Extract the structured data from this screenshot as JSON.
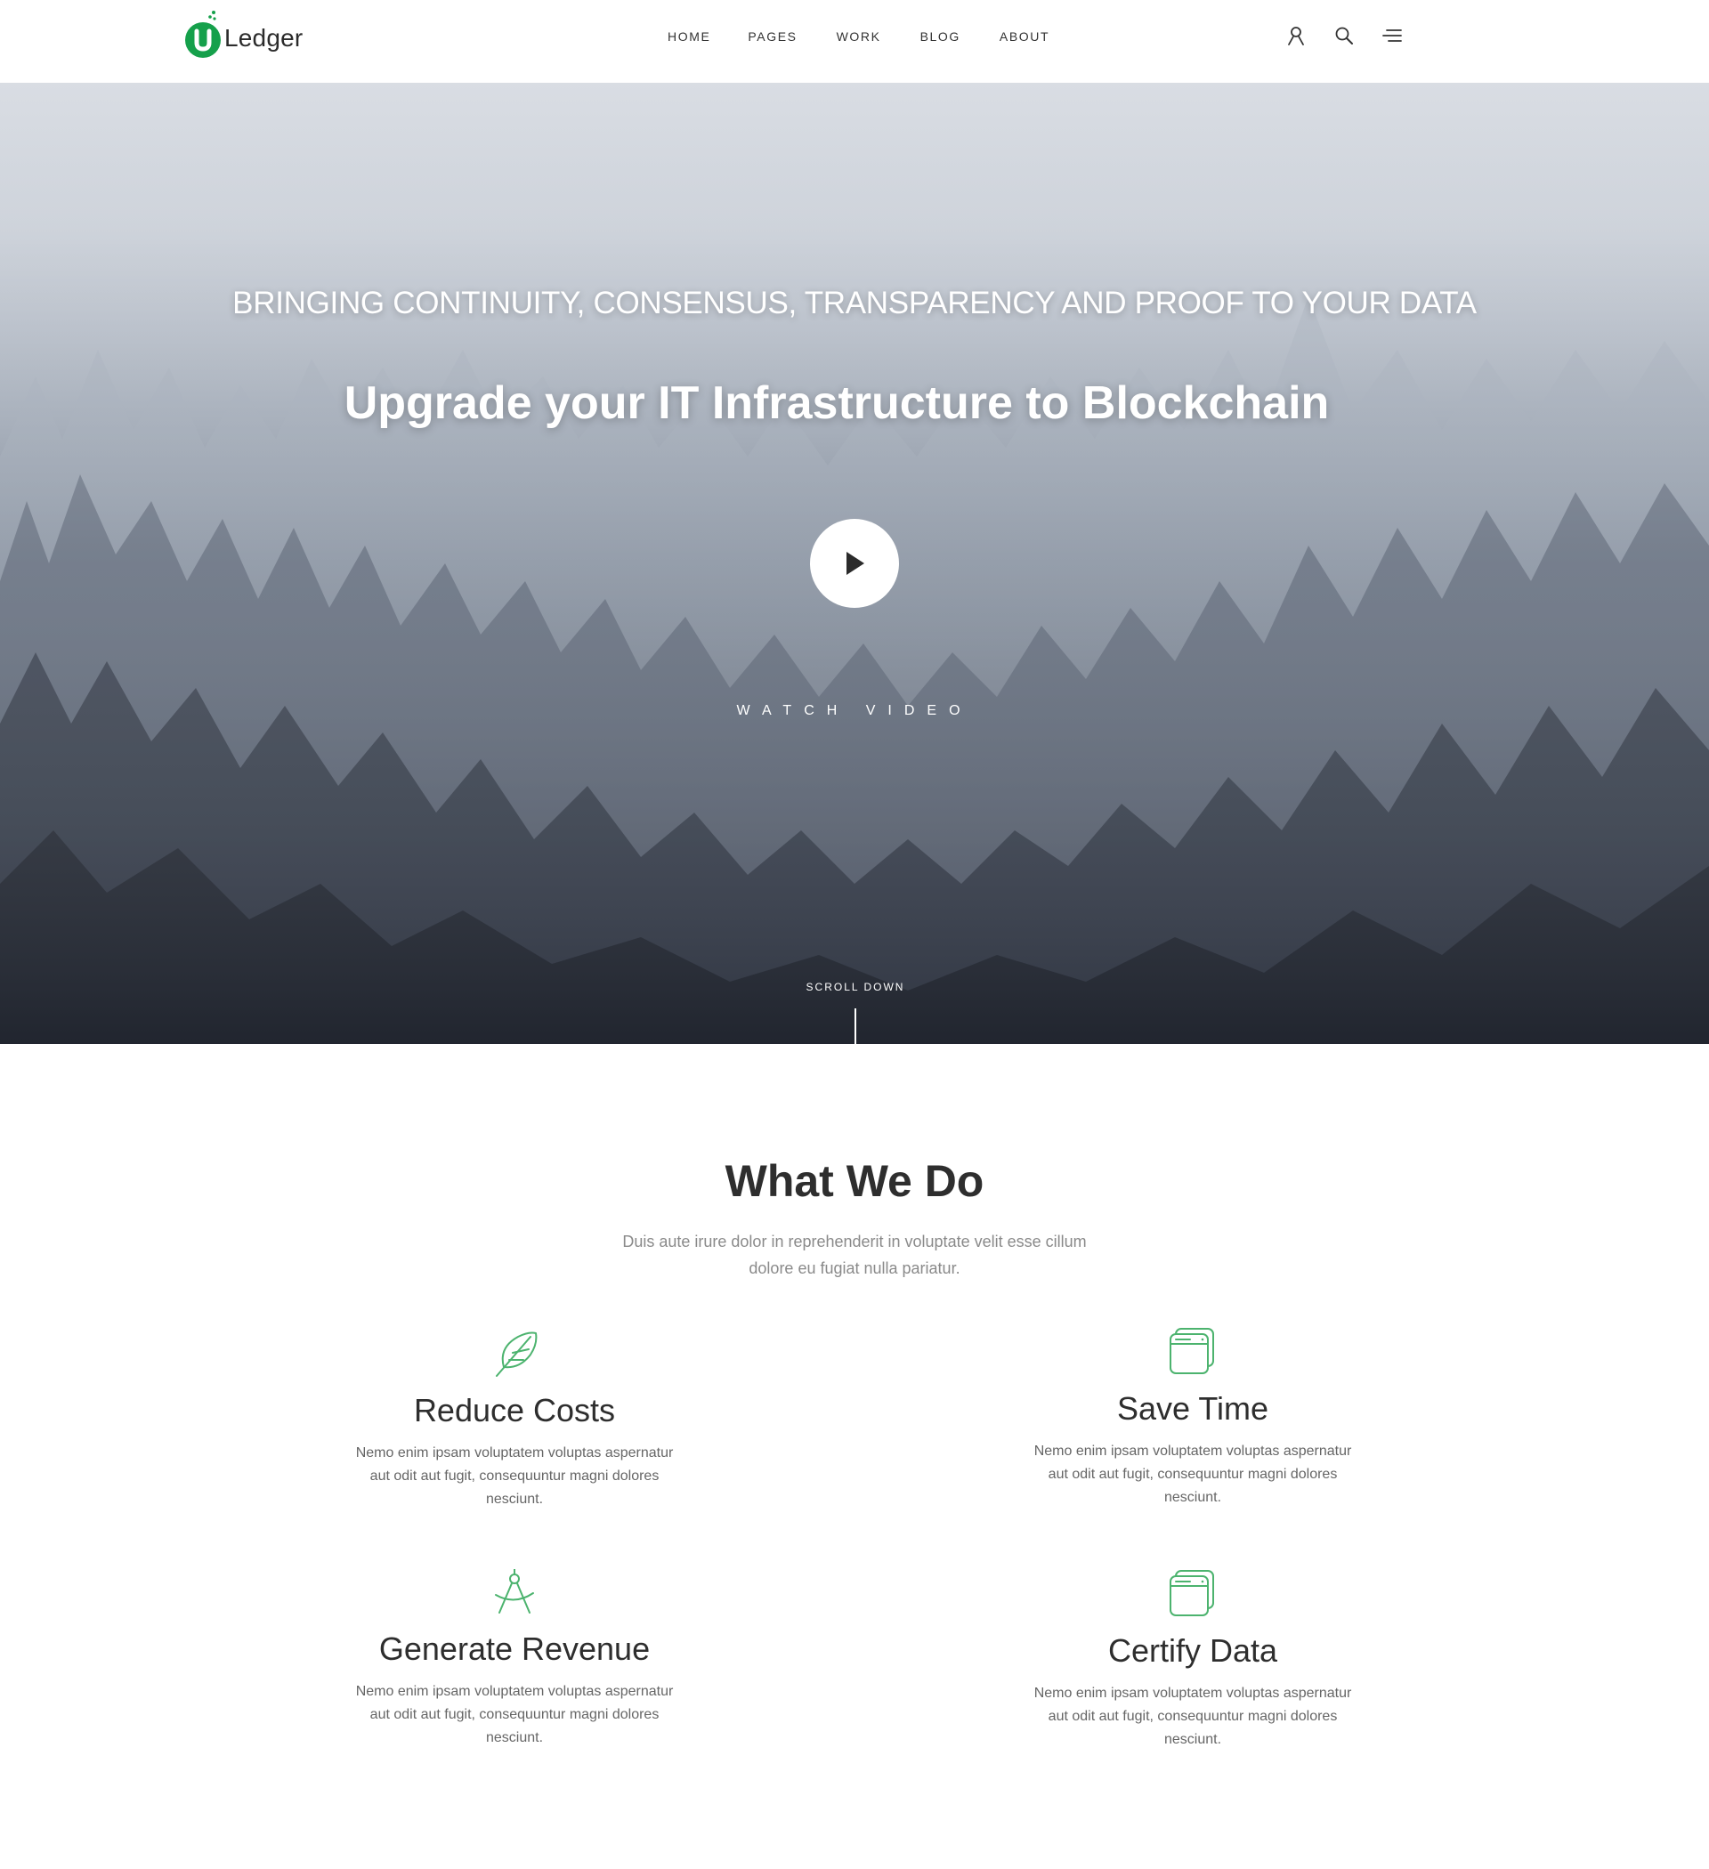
{
  "brand": {
    "logo_letter": "U",
    "name": "Ledger",
    "accent_color": "#15a04b"
  },
  "nav": {
    "items": [
      "HOME",
      "PAGES",
      "WORK",
      "BLOG",
      "ABOUT"
    ]
  },
  "header_icons": [
    "user-icon",
    "search-icon",
    "menu-icon"
  ],
  "hero": {
    "tagline": "BRINGING CONTINUITY, CONSENSUS, TRANSPARENCY AND PROOF TO YOUR DATA",
    "title": "Upgrade your IT Infrastructure to Blockchain",
    "watch_label": "WATCH VIDEO",
    "scroll_label": "SCROLL DOWN"
  },
  "what_we_do": {
    "title": "What We Do",
    "subtitle": "Duis aute irure dolor in reprehenderit in voluptate velit esse cillum dolore eu fugiat nulla pariatur.",
    "icon_color": "#4cb36e",
    "features": [
      {
        "title": "Reduce Costs",
        "text": "Nemo enim ipsam voluptatem voluptas aspernatur aut odit aut fugit, consequuntur magni dolores nesciunt.",
        "icon": "feather-icon"
      },
      {
        "title": "Save Time",
        "text": "Nemo enim ipsam voluptatem voluptas aspernatur aut odit aut fugit, consequuntur magni dolores nesciunt.",
        "icon": "browser-windows-icon"
      },
      {
        "title": "Generate Revenue",
        "text": "Nemo enim ipsam voluptatem voluptas aspernatur aut odit aut fugit, consequuntur magni dolores nesciunt.",
        "icon": "compass-icon"
      },
      {
        "title": "Certify Data",
        "text": "Nemo enim ipsam voluptatem voluptas aspernatur aut odit aut fugit, consequuntur magni dolores nesciunt.",
        "icon": "browser-windows-icon"
      }
    ]
  }
}
